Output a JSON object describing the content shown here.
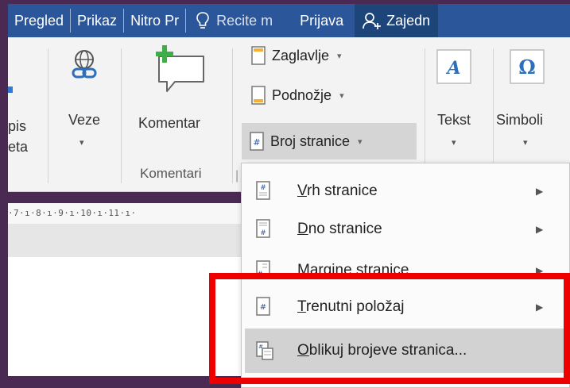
{
  "ribbon_tabs": {
    "review": "Pregled",
    "view": "Prikaz",
    "nitro": "Nitro Pr",
    "tell_me": "Recite m",
    "sign_in": "Prijava",
    "share": "Zajedn"
  },
  "ribbon": {
    "cut_label_line1": "pis",
    "cut_label_line2": "eta",
    "links": "Veze",
    "comment": "Komentar",
    "comments_group": "Komentari",
    "header": "Zaglavlje",
    "footer": "Podnožje",
    "page_number": "Broj stranice",
    "text": "Tekst",
    "symbols": "Simboli"
  },
  "ruler_text": "·7·ı·8·ı·9·ı·10·ı·11·ı·",
  "page_number_menu": [
    {
      "label": "Vrh stranice",
      "icon": "page-top-icon",
      "submenu": true
    },
    {
      "label": "Dno stranice",
      "icon": "page-bottom-icon",
      "submenu": true
    },
    {
      "label": "Margine stranice",
      "icon": "page-margins-icon",
      "submenu": true
    },
    {
      "label": "Trenutni položaj",
      "icon": "current-position-icon",
      "submenu": true
    },
    {
      "label": "Oblikuj brojeve stranica...",
      "icon": "format-page-numbers-icon",
      "submenu": false
    }
  ],
  "colors": {
    "ribbon_tab_bar": "#2b579a",
    "highlight": "#ee0000",
    "accent_green": "#3fae49"
  }
}
